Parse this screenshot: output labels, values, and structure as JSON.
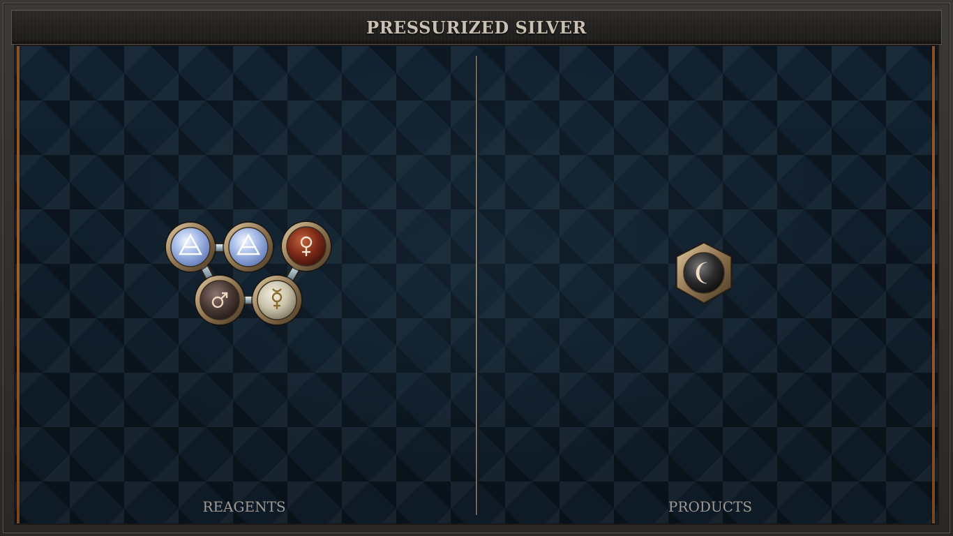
{
  "puzzle": {
    "title": "PRESSURIZED SILVER"
  },
  "panels": {
    "reagents_label": "REAGENTS",
    "products_label": "PRODUCTS"
  },
  "reagents": {
    "atoms": [
      {
        "element": "air",
        "glyph": "🜁",
        "icon": "air-icon"
      },
      {
        "element": "air",
        "glyph": "🜁",
        "icon": "air-icon"
      },
      {
        "element": "copper",
        "glyph": "♀",
        "icon": "copper-icon"
      },
      {
        "element": "iron",
        "glyph": "♂",
        "icon": "iron-icon"
      },
      {
        "element": "quicksilver",
        "glyph": "☿",
        "icon": "quicksilver-icon"
      }
    ]
  },
  "products": {
    "atoms": [
      {
        "element": "silver",
        "glyph": "☽",
        "icon": "silver-icon"
      }
    ]
  },
  "colors": {
    "title_text": "#c9bfb3",
    "label_text": "#9f9a94",
    "board_bg": "#0d1822",
    "edge_accent": "#a35d28"
  }
}
